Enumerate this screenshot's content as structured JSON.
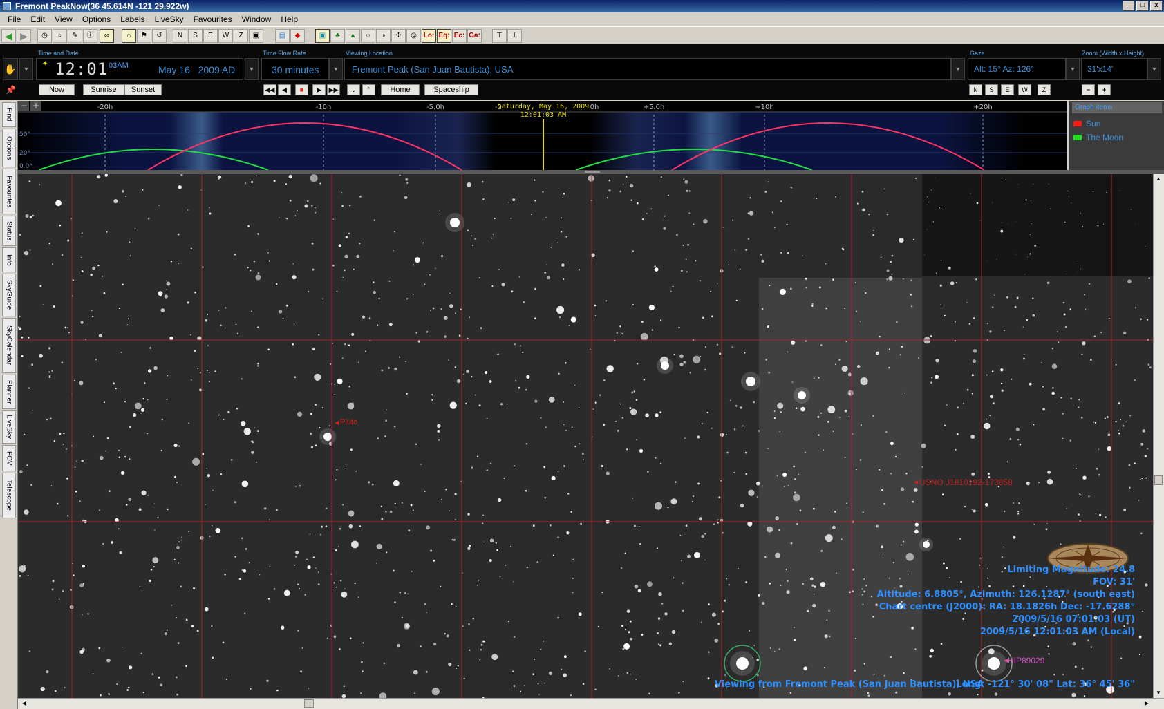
{
  "window": {
    "title": "Fremont PeakNow(36  45.614N -121 29.922w)",
    "buttons": [
      "_",
      "□",
      "x"
    ]
  },
  "menu": [
    "File",
    "Edit",
    "View",
    "Options",
    "Labels",
    "LiveSky",
    "Favourites",
    "Window",
    "Help"
  ],
  "toolbar": {
    "text_buttons": {
      "lo": "Lo:",
      "eq": "Eq:",
      "ec": "Ec:",
      "ga": "Ga:"
    }
  },
  "controls": {
    "time_date_label": "Time and Date",
    "time": "12:01",
    "seconds_ampm": "03AM",
    "date": "May 16   2009 AD",
    "time_flow_label": "Time Flow Rate",
    "time_flow": "30 minutes",
    "viewing_location_label": "Viewing Location",
    "viewing_location": "Fremont Peak (San Juan Bautista), USA",
    "gaze_label": "Gaze",
    "gaze": "Alt: 15° Az: 126°",
    "zoom_label": "Zoom (Width x Height)",
    "zoom": "31'x14'",
    "now": "Now",
    "sunrise": "Sunrise",
    "sunset": "Sunset",
    "home": "Home",
    "spaceship": "Spaceship",
    "directions": [
      "N",
      "S",
      "E",
      "W",
      "Z"
    ],
    "zoom_out": "−",
    "zoom_in": "+"
  },
  "sidetabs": [
    "Find",
    "Options",
    "Favourites",
    "Status",
    "Info",
    "SkyGuide",
    "SkyCalendar",
    "Planner",
    "LiveSky",
    "FOV",
    "Telescope"
  ],
  "timeline": {
    "ticks": [
      "-20h",
      "-10h",
      "-5.0h",
      "-2",
      "0h",
      "+5.0h",
      "+10h",
      "+20h"
    ],
    "altitude_labels": [
      "50°",
      "20°",
      "0.0°"
    ],
    "current_time_line1": "Saturday, May 16, 2009",
    "current_time_line2": "12:01:03 AM",
    "legend_header": "Graph items",
    "legend": [
      {
        "name": "Sun",
        "color": "#ff1a1a"
      },
      {
        "name": "The Moon",
        "color": "#22dd22"
      }
    ]
  },
  "sky": {
    "labels": {
      "pluto": "Pluto",
      "usno": "USNO J1810192-173858",
      "hip": "HIP89029"
    },
    "info": {
      "limiting_magnitude": "Limiting Magnitude: 24.8",
      "fov": "FOV: 31'",
      "alt_az": "Altitude:  6.8805°, Azimuth: 126.1287° (south east)",
      "chart_centre": "Chart centre (J2000): RA: 18.1826h Dec: -17.6288°",
      "utc": "2009/5/16 07:01:03 (UT)",
      "local": "2009/5/16 12:01:03 AM (Local)",
      "viewing_from": "Viewing from Fremont Peak (San Juan Bautista), USA",
      "coords": "Long: -121° 30' 08\"  Lat: 36° 45' 36\""
    }
  },
  "colors": {
    "accent": "#3a8fd6",
    "info_text": "#2e8fff",
    "grid": "#b0202a",
    "sun_curve": "#ff3366",
    "moon_curve": "#22dd44",
    "current_time": "#e8e000"
  }
}
